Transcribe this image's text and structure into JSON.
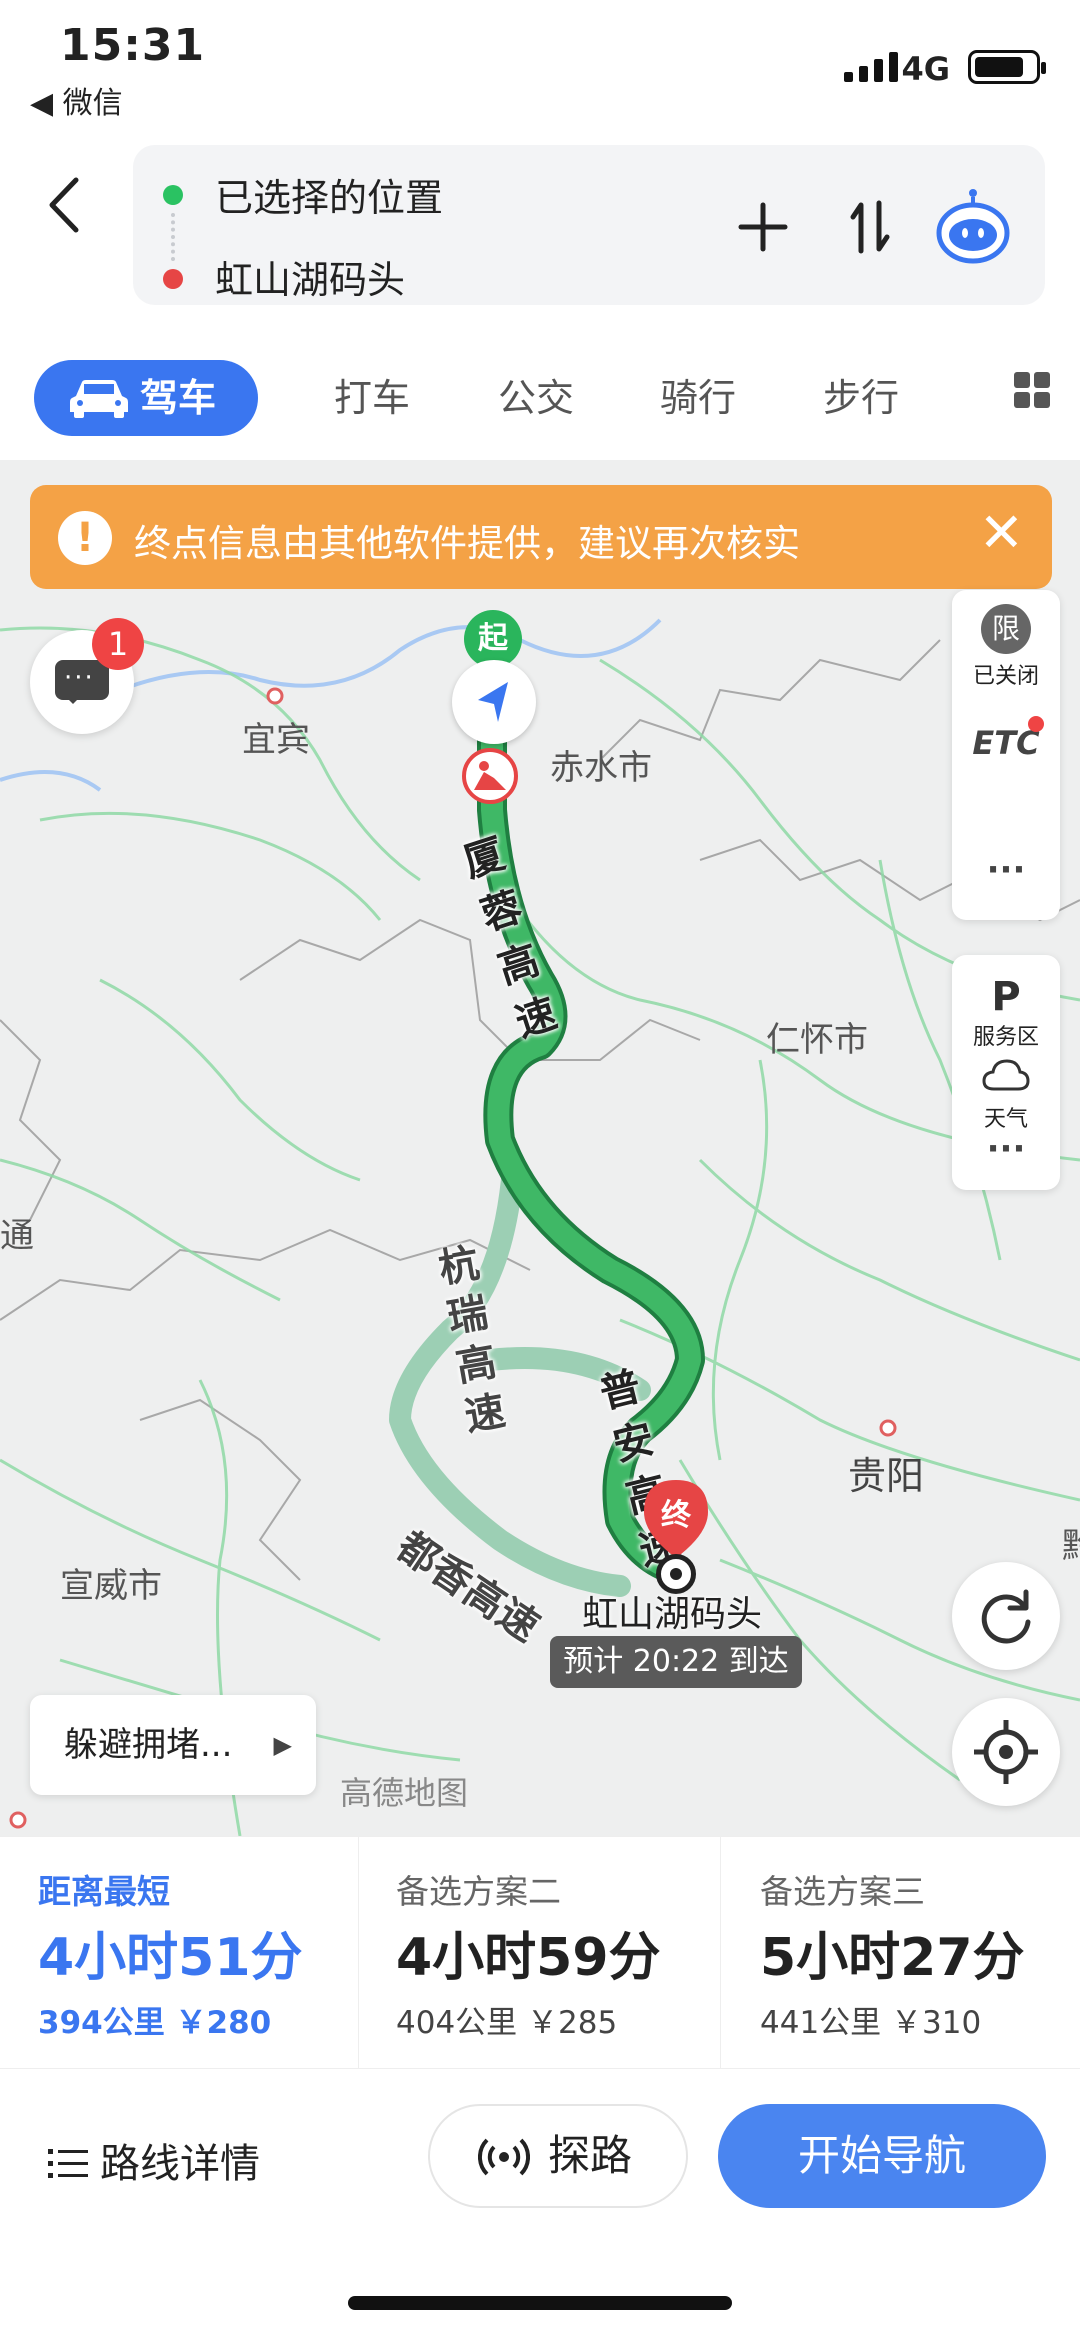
{
  "status_bar": {
    "time": "15:31",
    "back_app": "◀ 微信",
    "network": "4G"
  },
  "header": {
    "start_label": "已选择的位置",
    "end_label": "虹山湖码头",
    "icons": [
      "back-arrow-icon",
      "add-icon",
      "swap-icon",
      "assistant-icon"
    ]
  },
  "tabs": [
    {
      "label": "驾车",
      "active": true
    },
    {
      "label": "打车"
    },
    {
      "label": "公交"
    },
    {
      "label": "骑行"
    },
    {
      "label": "步行"
    }
  ],
  "map": {
    "banner": "终点信息由其他软件提供，建议再次核实",
    "message_badge": "1",
    "places": {
      "yibin": "宜宾",
      "chishui": "赤水市",
      "renhuai": "仁怀市",
      "guiyang": "贵阳",
      "xuanwei": "宣威市",
      "tong": "通",
      "qian": "黔"
    },
    "roads": {
      "xiarong": "厦蓉高速",
      "puan": "普安高速",
      "hangrui": "杭瑞高速",
      "duxiang": "都香高速"
    },
    "start_marker": "起",
    "end_marker": "终",
    "destination": "虹山湖码头",
    "eta": "预计 20:22 到达",
    "side_top": {
      "restrict_icon": "限",
      "restrict_label": "已关闭",
      "etc": "ETC",
      "more": "···"
    },
    "side_mid": {
      "service_icon": "P",
      "service_label": "服务区",
      "weather_label": "天气",
      "more": "···"
    },
    "avoid_label": "躲避拥堵...",
    "watermark": "高德地图",
    "colors": {
      "main_route": "#3fb866",
      "alt_route": "#9ccfb4",
      "banner": "#f4a246",
      "accent": "#3a76f0"
    }
  },
  "plans": [
    {
      "tag": "距离最短",
      "duration": "4小时51分",
      "meta": "394公里 ￥280",
      "selected": true
    },
    {
      "tag": "备选方案二",
      "duration": "4小时59分",
      "meta": "404公里 ￥285"
    },
    {
      "tag": "备选方案三",
      "duration": "5小时27分",
      "meta": "441公里 ￥310"
    }
  ],
  "actions": {
    "detail": "路线详情",
    "explore": "探路",
    "navigate": "开始导航"
  }
}
